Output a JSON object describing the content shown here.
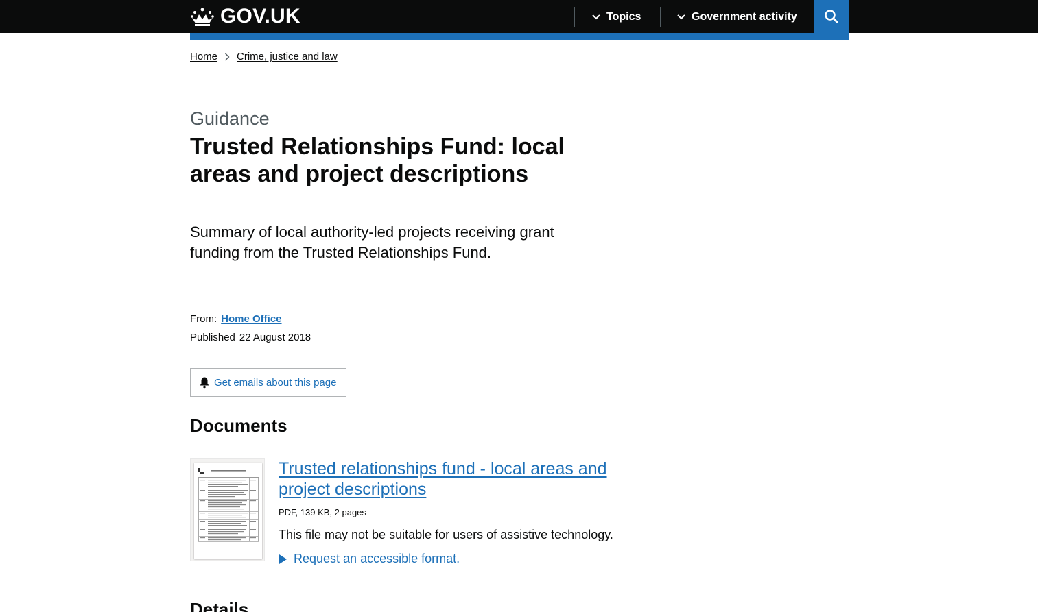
{
  "header": {
    "logo_text": "GOV.UK",
    "nav": [
      {
        "label": "Topics",
        "icon": "chevron-down-icon"
      },
      {
        "label": "Government activity",
        "icon": "chevron-down-icon"
      }
    ],
    "search_icon": "search-icon",
    "colors": {
      "bar": "#0b0c0c",
      "accent": "#1d70b8"
    }
  },
  "breadcrumb": [
    "Home",
    "Crime, justice and law"
  ],
  "page": {
    "caption": "Guidance",
    "title": "Trusted Relationships Fund: local areas and project descriptions",
    "summary": "Summary of local authority-led projects receiving grant funding from the Trusted Relationships Fund."
  },
  "metadata": {
    "from_label": "From:",
    "from_value": "Home Office",
    "published_label": "Published",
    "published_value": "22 August 2018"
  },
  "email_button": {
    "label": "Get emails about this page",
    "icon": "bell-icon"
  },
  "documents": {
    "heading": "Documents",
    "items": [
      {
        "title": "Trusted relationships fund - local areas and project descriptions",
        "meta": "PDF, 139 KB, 2 pages",
        "note": "This file may not be suitable for users of assistive technology.",
        "request_label": "Request an accessible format."
      }
    ]
  },
  "details_heading": "Details"
}
